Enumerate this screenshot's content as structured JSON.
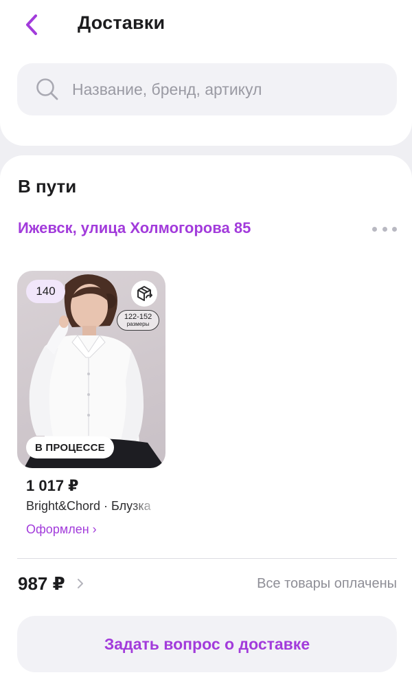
{
  "header": {
    "title": "Доставки",
    "back_icon": "chevron-left-icon"
  },
  "search": {
    "placeholder": "Название, бренд, артикул",
    "value": "",
    "icon": "search-icon"
  },
  "delivery": {
    "section_title": "В пути",
    "address": "Ижевск, улица Холмогорова 85",
    "more_icon": "more-horizontal-icon",
    "product": {
      "size": "140",
      "sizes_range": "122-152",
      "sizes_unit": "размеры",
      "status_badge": "В ПРОЦЕССЕ",
      "price": "1 017 ₽",
      "name": "Bright&Chord · Блузка",
      "order_status": "Оформлен ›",
      "return_icon": "return-box-icon"
    },
    "total": {
      "amount": "987 ₽",
      "payment_status": "Все товары оплачены"
    },
    "ask_button": "Задать вопрос о доставке"
  },
  "colors": {
    "accent": "#a23bdb",
    "background": "#efeff3",
    "card": "#ffffff",
    "field": "#f2f2f6",
    "size_badge": "#f1e6fa",
    "muted_text": "#8e8e96"
  }
}
